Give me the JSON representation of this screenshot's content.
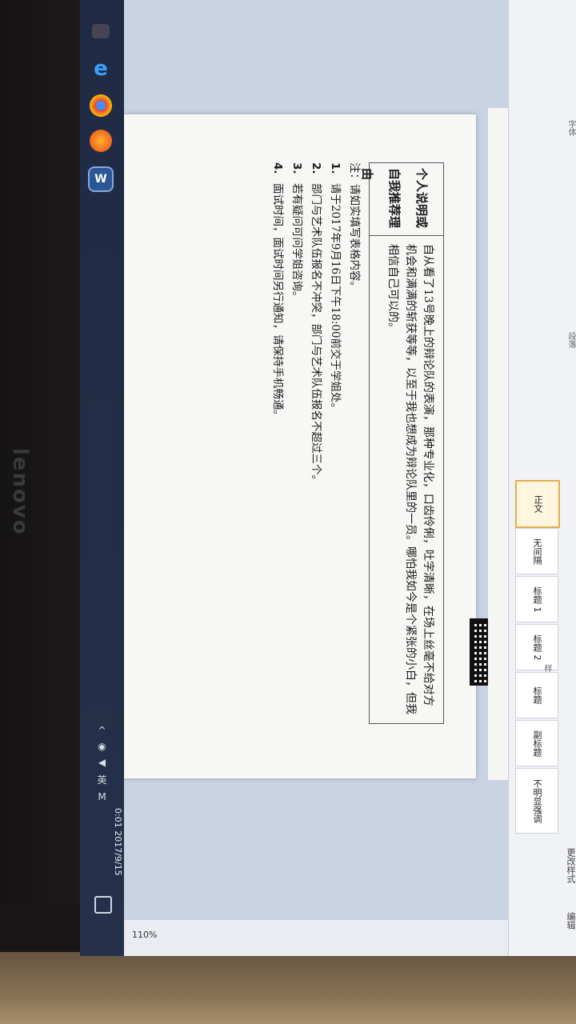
{
  "document": {
    "table_label": "个人说明或自我推荐理由",
    "table_text": "自从看了13号晚上的辩论队的表演，那种专业化，口齿伶俐，吐字清晰，在场上丝毫不给对方机会和满满的斩获等等，以至于我也想成为辩论队里的一员。哪怕我如今是个紧张的小白，但我相信自己可以的。",
    "notes_header": "注：请如实填写表格内容。",
    "notes": [
      {
        "num": "1.",
        "text": "请于2017年9月16日下午18:00前交于学姐处。"
      },
      {
        "num": "2.",
        "text": "部门与艺术队伍报名不冲突，部门与艺术队伍报名不超过三个。"
      },
      {
        "num": "3.",
        "text": "若有疑问可问学姐咨询。"
      },
      {
        "num": "4.",
        "text": "面试时间，面试时间另行通知，请保持手机畅通。"
      }
    ]
  },
  "ribbon": {
    "font_group": "字体",
    "paragraph_group": "段落",
    "styles_group": "样式",
    "styles": [
      "正文",
      "无间隔",
      "标题 1",
      "标题 2",
      "标题",
      "副标题",
      "不明显强调"
    ],
    "change_styles": "更改样式",
    "edit_group": "编辑"
  },
  "statusbar": {
    "zoom": "110%"
  },
  "taskbar": {
    "time": "0:01",
    "date": "2017/9/15",
    "lang": "英",
    "ime": "M"
  },
  "device": {
    "brand": "lenovo"
  }
}
